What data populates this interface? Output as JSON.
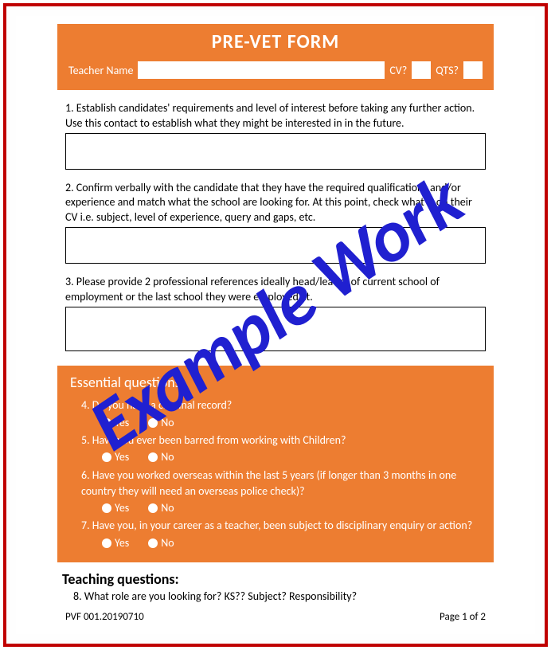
{
  "header": {
    "title": "PRE-VET FORM",
    "teacher_label": "Teacher Name",
    "teacher_value": "",
    "cv_label": "CV?",
    "cv_value": "",
    "qts_label": "QTS?",
    "qts_value": ""
  },
  "questions": {
    "q1": "1. Establish candidates' requirements and level of interest before taking any further action. Use this contact to establish what they might be interested in in the future.",
    "q1_answer": "",
    "q2": "2. Confirm verbally with the candidate that they have the required qualifications and/or experience and match what the school are looking for. At this point, check what is on their CV i.e. subject, level of experience, query and gaps, etc.",
    "q2_answer": "",
    "q3": "3. Please provide 2 professional references ideally head/leader of current school of employment or the last school they were employed at.",
    "q3_answer": ""
  },
  "essential": {
    "title": "Essential questions:",
    "q4": "4. Do you have a criminal record?",
    "q5": "5. Have you ever been barred from working with Children?",
    "q6": "6. Have you worked overseas within the last 5 years (if longer than 3 months in one country they will need an overseas police check)?",
    "q7": "7. Have you, in your career as a teacher, been subject to disciplinary enquiry or action?",
    "yes": "Yes",
    "no": "No"
  },
  "teaching": {
    "title": "Teaching questions:",
    "q8": "8. What role are you looking for? KS?? Subject? Responsibility?"
  },
  "footer": {
    "doc_id": "PVF 001.20190710",
    "page": "Page 1 of 2"
  },
  "watermark": "Example Work"
}
